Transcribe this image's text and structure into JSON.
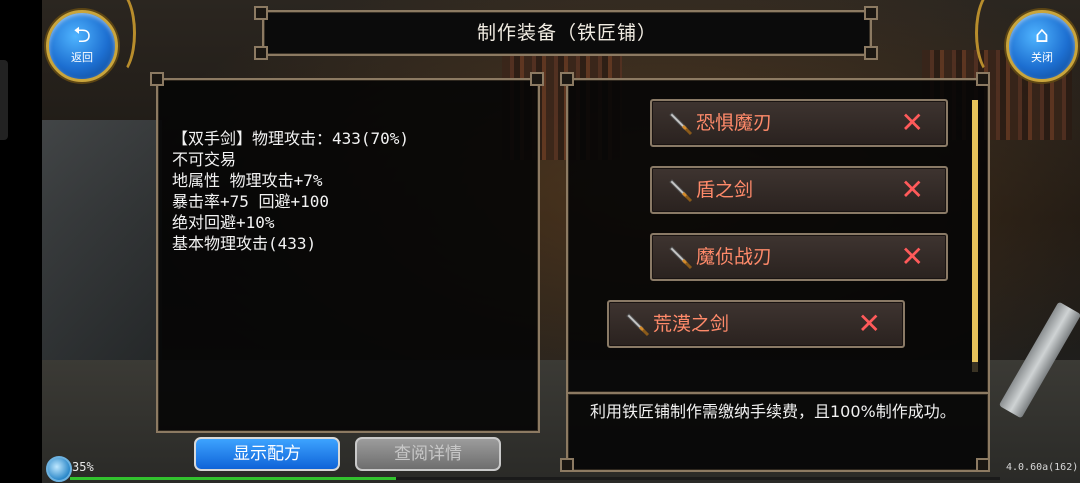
{
  "nav": {
    "back_label": "返回",
    "close_label": "关闭"
  },
  "title": "制作装备（铁匠铺）",
  "item_description": {
    "lines": [
      "【双手剑】物理攻击：433(70%)",
      "不可交易",
      "地属性 物理攻击+7%",
      "暴击率+75 回避+100",
      "绝对回避+10%",
      "基本物理攻击(433)"
    ]
  },
  "recipes": [
    {
      "name": "恐惧魔刃",
      "remove_icon": "x-icon"
    },
    {
      "name": "盾之剑",
      "remove_icon": "x-icon"
    },
    {
      "name": "魔侦战刃",
      "remove_icon": "x-icon"
    },
    {
      "name": "荒漠之剑",
      "remove_icon": "x-icon"
    }
  ],
  "info_text": "利用铁匠铺制作需缴纳手续费，且100%制作成功。",
  "buttons": {
    "show_recipe": "显示配方",
    "view_details": "查阅详情"
  },
  "status": {
    "percent": "35%",
    "version": "4.0.60a(162)",
    "progress_fraction": 0.35
  },
  "colors": {
    "recipe_name": "#ff8a6a",
    "remove_x": "#ff5a5a",
    "primary_button": "#1f7cf0",
    "disabled_button": "#8a8a8a",
    "panel_border": "#8c7a62"
  }
}
